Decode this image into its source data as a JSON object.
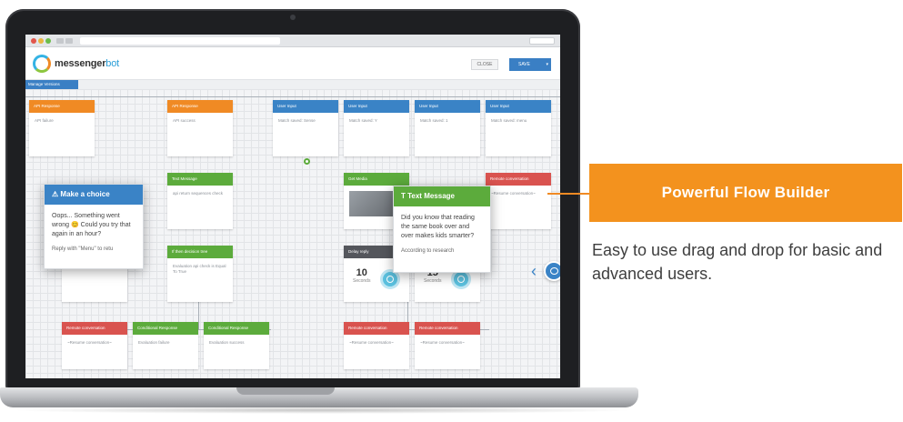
{
  "app": {
    "logo_main": "messenger",
    "logo_accent": "bot",
    "close_label": "CLOSE",
    "save_label": "SAVE",
    "save_dropdown": "▾",
    "manage_versions": "Manage Versions"
  },
  "nodes": {
    "row1": [
      {
        "header": "API Response",
        "body": "API failure"
      },
      {
        "header": "API Response",
        "body": "API success"
      },
      {
        "header": "User Input",
        "body": "Match saved: Sense"
      },
      {
        "header": "User Input",
        "body": "Match saved: Y"
      },
      {
        "header": "User Input",
        "body": "Match saved: 1"
      },
      {
        "header": "User Input",
        "body": "Match saved: menu"
      }
    ],
    "row2": [
      {
        "header": "Text Message",
        "body": "api return sequences check"
      },
      {
        "header": "Get Media",
        "body": ""
      },
      {
        "header": "Remote conversation",
        "body": "~Resume conversation~"
      }
    ],
    "row3": [
      {
        "header": "User Input",
        "body": "Match saved: menu"
      },
      {
        "header": "If then decision tree",
        "body": "Evaluation api check is Equal To True"
      },
      {
        "header": "Delay reply",
        "timer_value": "10",
        "timer_unit": "Seconds"
      },
      {
        "header": "Delay reply",
        "timer_value": "15",
        "timer_unit": "Seconds"
      }
    ],
    "row4": [
      {
        "header": "Remote conversation",
        "body": "~Resume conversation~"
      },
      {
        "header": "Conditional Response",
        "body": "Evaluation failure"
      },
      {
        "header": "Conditional Response",
        "body": "Evaluation success"
      },
      {
        "header": "Remote conversation",
        "body": "~Resume conversation~"
      },
      {
        "header": "Remote conversation",
        "body": "~Resume conversation~"
      }
    ]
  },
  "popups": {
    "choice": {
      "title": "Make a choice",
      "body": "Oops... Something went wrong 😊 Could you try that again in an hour?",
      "footer": "Reply with \"Menu\" to retu"
    },
    "text_message": {
      "title": "Text Message",
      "body": "Did you know that reading the same book over and over makes kids smarter?",
      "footer": "According to research"
    }
  },
  "marketing": {
    "callout_title": "Powerful Flow Builder",
    "description": "Easy to use drag and drop for basic and advanced users."
  },
  "colors": {
    "accent_orange": "#f3921e",
    "node_blue": "#3a83c6",
    "node_green": "#5cab3c",
    "node_red": "#d9534f",
    "node_orange": "#f08a24"
  }
}
